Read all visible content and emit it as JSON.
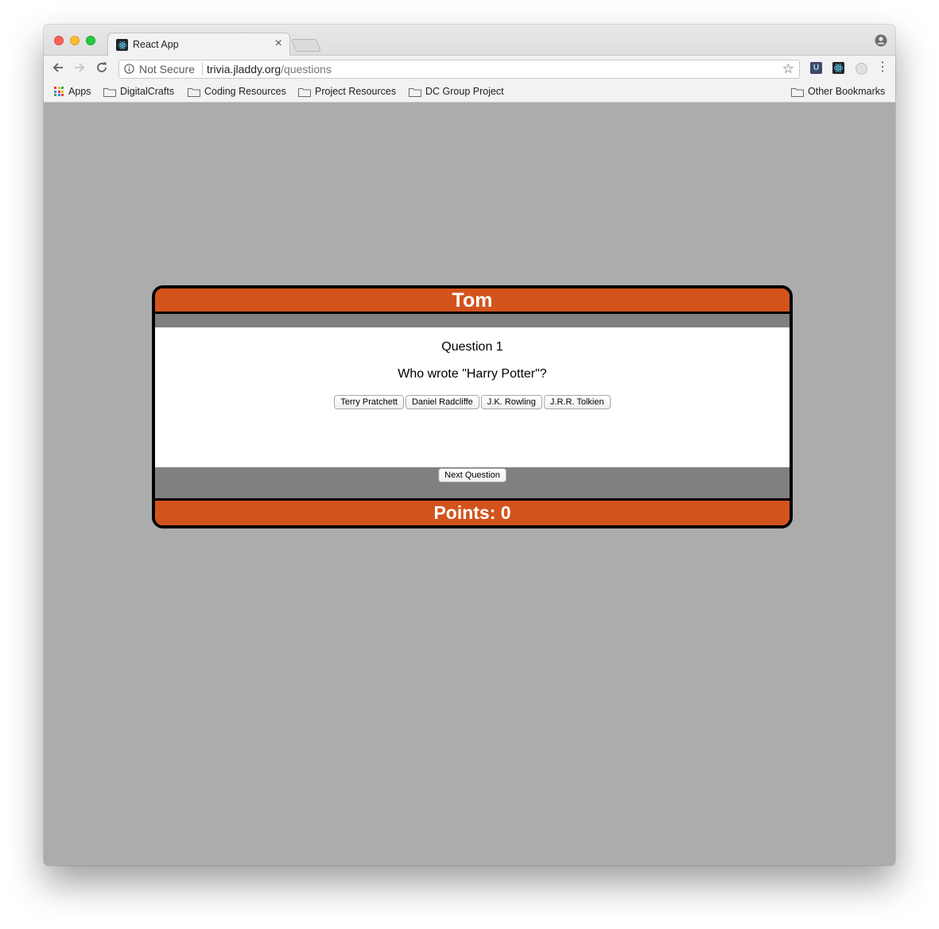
{
  "browser": {
    "tab_title": "React App",
    "tab_close": "×",
    "not_secure": "Not Secure",
    "url_host": "trivia.jladdy.org",
    "url_path": "/questions",
    "bookmarks": [
      "Apps",
      "DigitalCrafts",
      "Coding Resources",
      "Project Resources",
      "DC Group Project"
    ],
    "other_bookmarks": "Other Bookmarks"
  },
  "game": {
    "player_name": "Tom",
    "question_label": "Question 1",
    "question_text": "Who wrote \"Harry Potter\"?",
    "answers": [
      "Terry Pratchett",
      "Daniel Radcliffe",
      "J.K. Rowling",
      "J.R.R. Tolkien"
    ],
    "next_label": "Next Question",
    "points_text": "Points: 0"
  },
  "colors": {
    "accent": "#d3531d",
    "band": "#808080",
    "background": "#acacac"
  }
}
